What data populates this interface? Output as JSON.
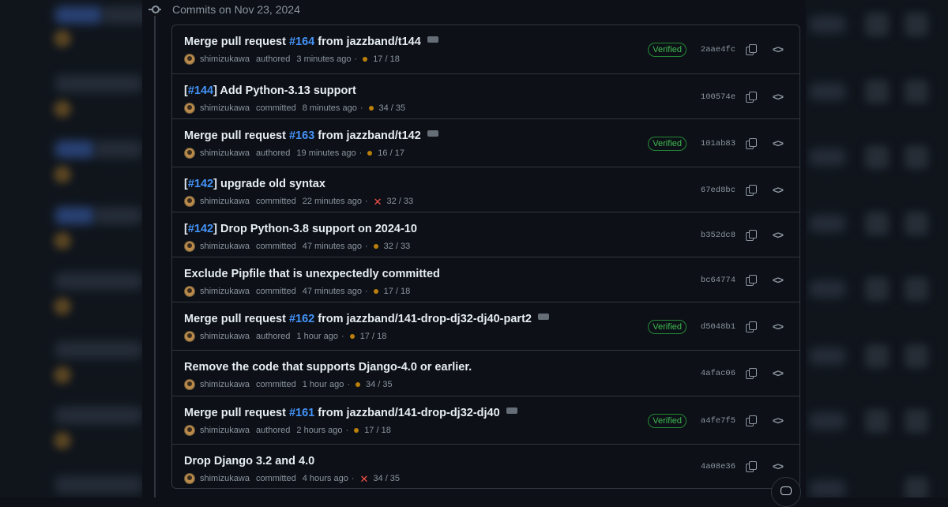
{
  "heading": {
    "date_label": "Commits on Nov 23, 2024"
  },
  "commits": [
    {
      "title_pre": "Merge pull request ",
      "pr": "#164",
      "title_post": " from jazzband/t144",
      "has_ellipsis": true,
      "author": "shimizukawa",
      "action": "authored",
      "time": "3 minutes ago",
      "status": "pending",
      "checks": "17 / 18",
      "verified": "Verified",
      "sha": "2aae4fc"
    },
    {
      "title_pre": "[",
      "pr": "#144",
      "title_post": "] Add Python-3.13 support",
      "has_ellipsis": false,
      "author": "shimizukawa",
      "action": "committed",
      "time": "8 minutes ago",
      "status": "pending",
      "checks": "34 / 35",
      "verified": "",
      "sha": "100574e"
    },
    {
      "title_pre": "Merge pull request ",
      "pr": "#163",
      "title_post": " from jazzband/t142",
      "has_ellipsis": true,
      "author": "shimizukawa",
      "action": "authored",
      "time": "19 minutes ago",
      "status": "pending",
      "checks": "16 / 17",
      "verified": "Verified",
      "sha": "101ab83"
    },
    {
      "title_pre": "[",
      "pr": "#142",
      "title_post": "] upgrade old syntax",
      "has_ellipsis": false,
      "author": "shimizukawa",
      "action": "committed",
      "time": "22 minutes ago",
      "status": "failed",
      "checks": "32 / 33",
      "verified": "",
      "sha": "67ed8bc"
    },
    {
      "title_pre": "[",
      "pr": "#142",
      "title_post": "] Drop Python-3.8 support on 2024-10",
      "has_ellipsis": false,
      "author": "shimizukawa",
      "action": "committed",
      "time": "47 minutes ago",
      "status": "pending",
      "checks": "32 / 33",
      "verified": "",
      "sha": "b352dc8"
    },
    {
      "title_pre": "Exclude Pipfile that is unexpectedly committed",
      "pr": "",
      "title_post": "",
      "has_ellipsis": false,
      "author": "shimizukawa",
      "action": "committed",
      "time": "47 minutes ago",
      "status": "pending",
      "checks": "17 / 18",
      "verified": "",
      "sha": "bc64774"
    },
    {
      "title_pre": "Merge pull request ",
      "pr": "#162",
      "title_post": " from jazzband/141-drop-dj32-dj40-part2",
      "has_ellipsis": true,
      "author": "shimizukawa",
      "action": "authored",
      "time": "1 hour ago",
      "status": "pending",
      "checks": "17 / 18",
      "verified": "Verified",
      "sha": "d5048b1"
    },
    {
      "title_pre": "Remove the code that supports Django-4.0 or earlier.",
      "pr": "",
      "title_post": "",
      "has_ellipsis": false,
      "author": "shimizukawa",
      "action": "committed",
      "time": "1 hour ago",
      "status": "pending",
      "checks": "34 / 35",
      "verified": "",
      "sha": "4afac06"
    },
    {
      "title_pre": "Merge pull request ",
      "pr": "#161",
      "title_post": " from jazzband/141-drop-dj32-dj40",
      "has_ellipsis": true,
      "author": "shimizukawa",
      "action": "authored",
      "time": "2 hours ago",
      "status": "pending",
      "checks": "17 / 18",
      "verified": "Verified",
      "sha": "a4fe7f5"
    },
    {
      "title_pre": "Drop Django 3.2 and 4.0",
      "pr": "",
      "title_post": "",
      "has_ellipsis": false,
      "author": "shimizukawa",
      "action": "committed",
      "time": "4 hours ago",
      "status": "failed",
      "checks": "34 / 35",
      "verified": "",
      "sha": "4a08e36"
    }
  ],
  "colors": {
    "accent_link": "#4493f8",
    "verified_green": "#3fb950",
    "pending_amber": "#bb8009",
    "failed_red": "#f85149",
    "background": "#0d1117",
    "border": "#30363d"
  },
  "icons": {
    "commit": "git-commit-icon",
    "copy": "copy-icon",
    "browse": "code-icon",
    "copilot": "copilot-icon",
    "ellipsis": "kebab-horizontal-icon"
  }
}
